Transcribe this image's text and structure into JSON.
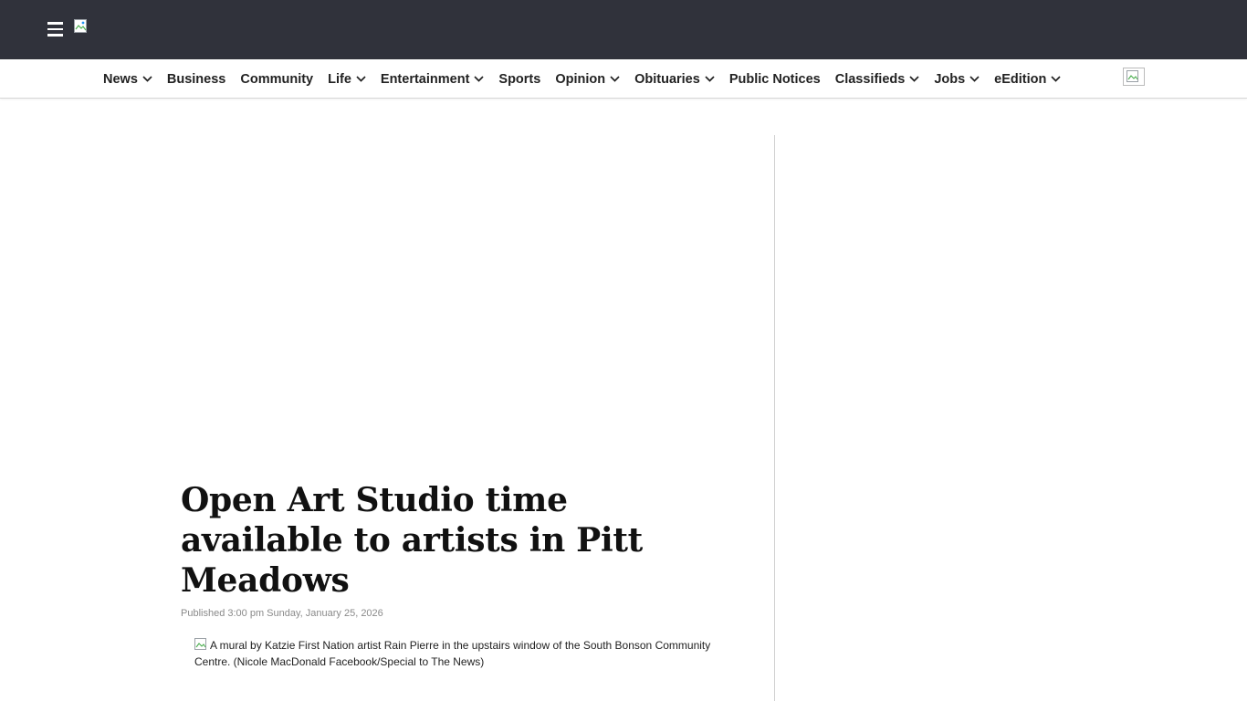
{
  "header": {
    "menu_icon": "hamburger-menu-icon",
    "logo_icon": "broken-image-icon",
    "background_color": "#30323b"
  },
  "nav": {
    "items": [
      {
        "label": "News",
        "has_dropdown": true
      },
      {
        "label": "Business",
        "has_dropdown": false
      },
      {
        "label": "Community",
        "has_dropdown": false
      },
      {
        "label": "Life",
        "has_dropdown": true
      },
      {
        "label": "Entertainment",
        "has_dropdown": true
      },
      {
        "label": "Sports",
        "has_dropdown": false
      },
      {
        "label": "Opinion",
        "has_dropdown": true
      },
      {
        "label": "Obituaries",
        "has_dropdown": true
      },
      {
        "label": "Public Notices",
        "has_dropdown": false
      },
      {
        "label": "Classifieds",
        "has_dropdown": true
      },
      {
        "label": "Jobs",
        "has_dropdown": true
      },
      {
        "label": "eEdition",
        "has_dropdown": true
      }
    ],
    "trailing_icon": "broken-image-icon",
    "dropdown_icon": "chevron-down-icon"
  },
  "article": {
    "headline": "Open Art Studio time available to artists in Pitt Meadows",
    "published": "Published 3:00 pm Sunday, January 25, 2026",
    "image_caption": "A mural by Katzie First Nation artist Rain Pierre in the upstairs window of the South Bonson Community Centre. (Nicole MacDonald Facebook/Special to The News)"
  }
}
